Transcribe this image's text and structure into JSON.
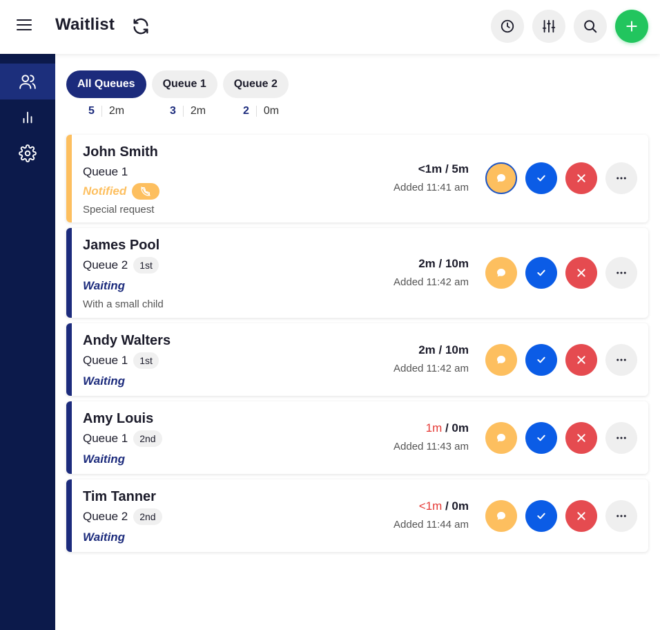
{
  "app": {
    "title": "Waitlist"
  },
  "topbar": {
    "icons": [
      "menu-icon",
      "refresh-icon",
      "history-icon",
      "filter-sliders-icon",
      "search-icon",
      "plus-icon"
    ]
  },
  "sidebar": {
    "items": [
      {
        "icon": "users-icon",
        "active": true
      },
      {
        "icon": "bar-chart-icon",
        "active": false
      },
      {
        "icon": "gear-icon",
        "active": false
      }
    ]
  },
  "tabs": [
    {
      "label": "All Queues",
      "active": true,
      "count": "5",
      "time": "2m"
    },
    {
      "label": "Queue 1",
      "active": false,
      "count": "3",
      "time": "2m"
    },
    {
      "label": "Queue 2",
      "active": false,
      "count": "2",
      "time": "0m"
    }
  ],
  "colors": {
    "navy": "#0c1a4b",
    "accent": "#1c2b7c",
    "notified": "#fdbf5f",
    "confirm": "#0b5ce6",
    "cancel": "#e54b50",
    "add": "#22c55e",
    "overdue": "#e53935"
  },
  "entries": [
    {
      "name": "John Smith",
      "queue": "Queue 1",
      "position": "",
      "status": "Notified",
      "note": "Special request",
      "wait_elapsed": "<1m",
      "wait_quote": "5m",
      "elapsed_overdue": false,
      "added": "Added 11:41 am"
    },
    {
      "name": "James Pool",
      "queue": "Queue 2",
      "position": "1st",
      "status": "Waiting",
      "note": "With a small child",
      "wait_elapsed": "2m",
      "wait_quote": "10m",
      "elapsed_overdue": false,
      "added": "Added 11:42 am"
    },
    {
      "name": "Andy Walters",
      "queue": "Queue 1",
      "position": "1st",
      "status": "Waiting",
      "note": "",
      "wait_elapsed": "2m",
      "wait_quote": "10m",
      "elapsed_overdue": false,
      "added": "Added 11:42 am"
    },
    {
      "name": "Amy Louis",
      "queue": "Queue 1",
      "position": "2nd",
      "status": "Waiting",
      "note": "",
      "wait_elapsed": "1m",
      "wait_quote": "0m",
      "elapsed_overdue": true,
      "added": "Added 11:43 am"
    },
    {
      "name": "Tim Tanner",
      "queue": "Queue 2",
      "position": "2nd",
      "status": "Waiting",
      "note": "",
      "wait_elapsed": "<1m",
      "wait_quote": "0m",
      "elapsed_overdue": true,
      "added": "Added 11:44 am"
    }
  ]
}
